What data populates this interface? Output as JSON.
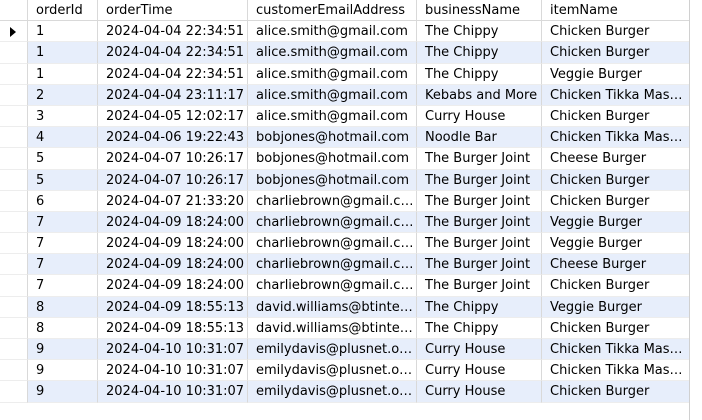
{
  "columns": [
    "orderId",
    "orderTime",
    "customerEmailAddress",
    "businessName",
    "itemName"
  ],
  "rows": [
    [
      "1",
      "2024-04-04 22:34:51",
      "alice.smith@gmail.com",
      "The Chippy",
      "Chicken Burger"
    ],
    [
      "1",
      "2024-04-04 22:34:51",
      "alice.smith@gmail.com",
      "The Chippy",
      "Chicken Burger"
    ],
    [
      "1",
      "2024-04-04 22:34:51",
      "alice.smith@gmail.com",
      "The Chippy",
      "Veggie Burger"
    ],
    [
      "2",
      "2024-04-04 23:11:17",
      "alice.smith@gmail.com",
      "Kebabs and More",
      "Chicken Tikka Masala"
    ],
    [
      "3",
      "2024-04-05 12:02:17",
      "alice.smith@gmail.com",
      "Curry House",
      "Chicken Burger"
    ],
    [
      "4",
      "2024-04-06 19:22:43",
      "bobjones@hotmail.com",
      "Noodle Bar",
      "Chicken Tikka Masala"
    ],
    [
      "5",
      "2024-04-07 10:26:17",
      "bobjones@hotmail.com",
      "The Burger Joint",
      "Cheese Burger"
    ],
    [
      "5",
      "2024-04-07 10:26:17",
      "bobjones@hotmail.com",
      "The Burger Joint",
      "Chicken Burger"
    ],
    [
      "6",
      "2024-04-07 21:33:20",
      "charliebrown@gmail.com",
      "The Burger Joint",
      "Chicken Burger"
    ],
    [
      "7",
      "2024-04-09 18:24:00",
      "charliebrown@gmail.com",
      "The Burger Joint",
      "Veggie Burger"
    ],
    [
      "7",
      "2024-04-09 18:24:00",
      "charliebrown@gmail.com",
      "The Burger Joint",
      "Veggie Burger"
    ],
    [
      "7",
      "2024-04-09 18:24:00",
      "charliebrown@gmail.com",
      "The Burger Joint",
      "Cheese Burger"
    ],
    [
      "7",
      "2024-04-09 18:24:00",
      "charliebrown@gmail.com",
      "The Burger Joint",
      "Chicken Burger"
    ],
    [
      "8",
      "2024-04-09 18:55:13",
      "david.williams@btintern...",
      "The Chippy",
      "Veggie Burger"
    ],
    [
      "8",
      "2024-04-09 18:55:13",
      "david.williams@btintern...",
      "The Chippy",
      "Chicken Burger"
    ],
    [
      "9",
      "2024-04-10 10:31:07",
      "emilydavis@plusnet.org...",
      "Curry House",
      "Chicken Tikka Masala"
    ],
    [
      "9",
      "2024-04-10 10:31:07",
      "emilydavis@plusnet.org...",
      "Curry House",
      "Chicken Tikka Masala"
    ],
    [
      "9",
      "2024-04-10 10:31:07",
      "emilydavis@plusnet.org...",
      "Curry House",
      "Chicken Burger"
    ]
  ],
  "current_row_index": 0,
  "current_row_icon": "current-row-arrow-icon"
}
